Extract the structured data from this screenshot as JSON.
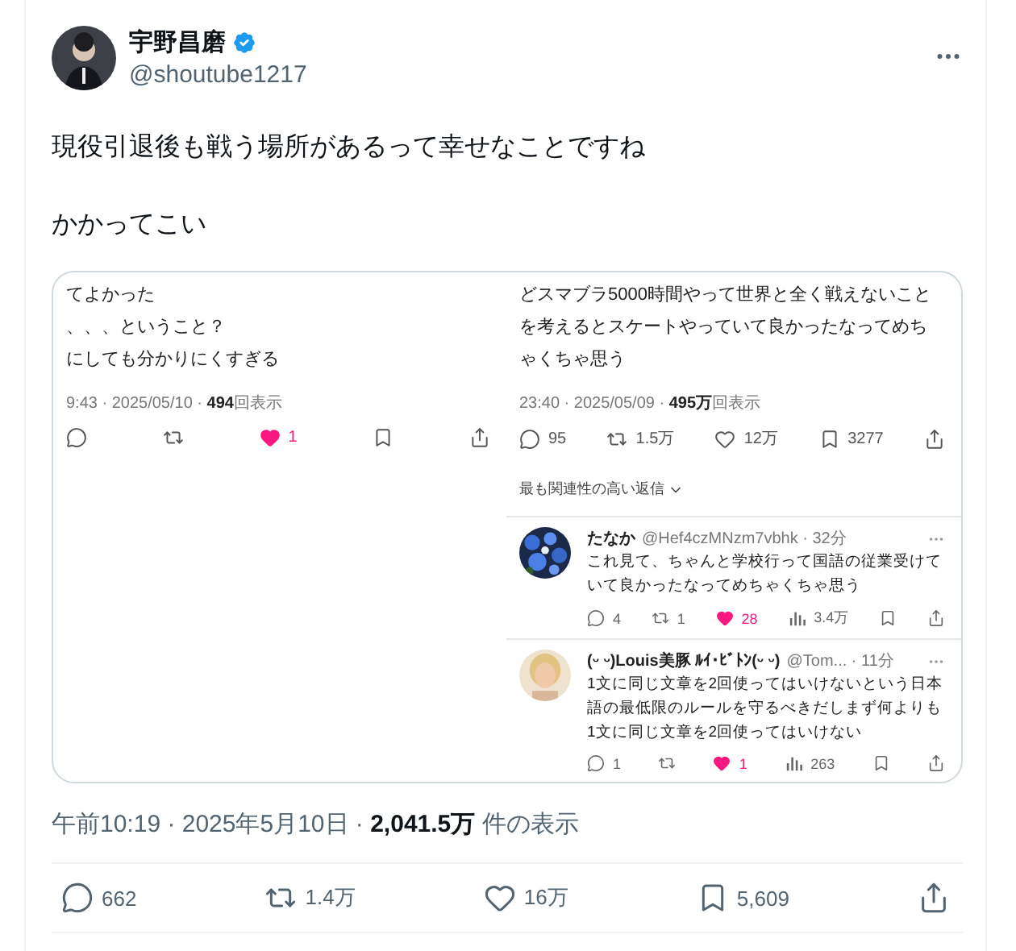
{
  "author": {
    "name": "宇野昌磨",
    "handle": "@shoutube1217",
    "verified": true
  },
  "text": [
    "現役引退後も戦う場所があるって幸せなことですね",
    "かかってこい"
  ],
  "embedded": {
    "left": {
      "lines": [
        "てよかった",
        "、、、ということ？",
        "にしても分かりにくすぎる"
      ],
      "meta": "9:43 · 2025/05/10 · **494**回表示",
      "actions": [
        {
          "kind": "reply"
        },
        {
          "kind": "repost"
        },
        {
          "kind": "like",
          "liked": true,
          "count": "1"
        },
        {
          "kind": "bookmark"
        },
        {
          "kind": "share"
        }
      ]
    },
    "right": {
      "lines": [
        "どスマブラ5000時間やって世界と全く戦えないこと",
        "を考えるとスケートやっていて良かったなってめち",
        "ゃくちゃ思う"
      ],
      "meta": "23:40 · 2025/05/09 · **495万**回表示",
      "actions": [
        {
          "kind": "reply",
          "count": "95"
        },
        {
          "kind": "repost",
          "count": "1.5万"
        },
        {
          "kind": "like",
          "liked": false,
          "count": "12万"
        },
        {
          "kind": "bookmark",
          "count": "3277"
        },
        {
          "kind": "share"
        }
      ],
      "sort_label": "最も関連性の高い返信",
      "replies": [
        {
          "name": "たなか",
          "handle": "@Hef4czMNzm7vbhk · 32分",
          "text": "これ見て、ちゃんと学校行って国語の従業受けていて良かったなってめちゃくちゃ思う",
          "actions": [
            {
              "kind": "reply",
              "count": "4"
            },
            {
              "kind": "repost",
              "count": "1"
            },
            {
              "kind": "like",
              "liked": true,
              "count": "28"
            },
            {
              "kind": "views",
              "count": "3.4万"
            },
            {
              "kind": "bookmark"
            },
            {
              "kind": "share"
            }
          ]
        },
        {
          "name": "(ᵕ ᵕ)Louis美豚 ﾙｲ･ﾋﾞﾄﾝ(ᵕ ᵕ)",
          "handle": "@Tom... · 11分",
          "text": "1文に同じ文章を2回使ってはいけないという日本語の最低限のルールを守るべきだしまず何よりも1文に同じ文章を2回使ってはいけない",
          "actions": [
            {
              "kind": "reply",
              "count": "1"
            },
            {
              "kind": "repost"
            },
            {
              "kind": "like",
              "liked": true,
              "count": "1"
            },
            {
              "kind": "views",
              "count": "263"
            },
            {
              "kind": "bookmark"
            },
            {
              "kind": "share"
            }
          ]
        }
      ]
    }
  },
  "footer": {
    "meta": "午前10:19 · 2025年5月10日 · **2,041.5万** 件の表示",
    "actions": [
      {
        "kind": "reply",
        "count": "662"
      },
      {
        "kind": "repost",
        "count": "1.4万"
      },
      {
        "kind": "like",
        "liked": false,
        "count": "16万"
      },
      {
        "kind": "bookmark",
        "count": "5,609"
      },
      {
        "kind": "share"
      }
    ]
  }
}
